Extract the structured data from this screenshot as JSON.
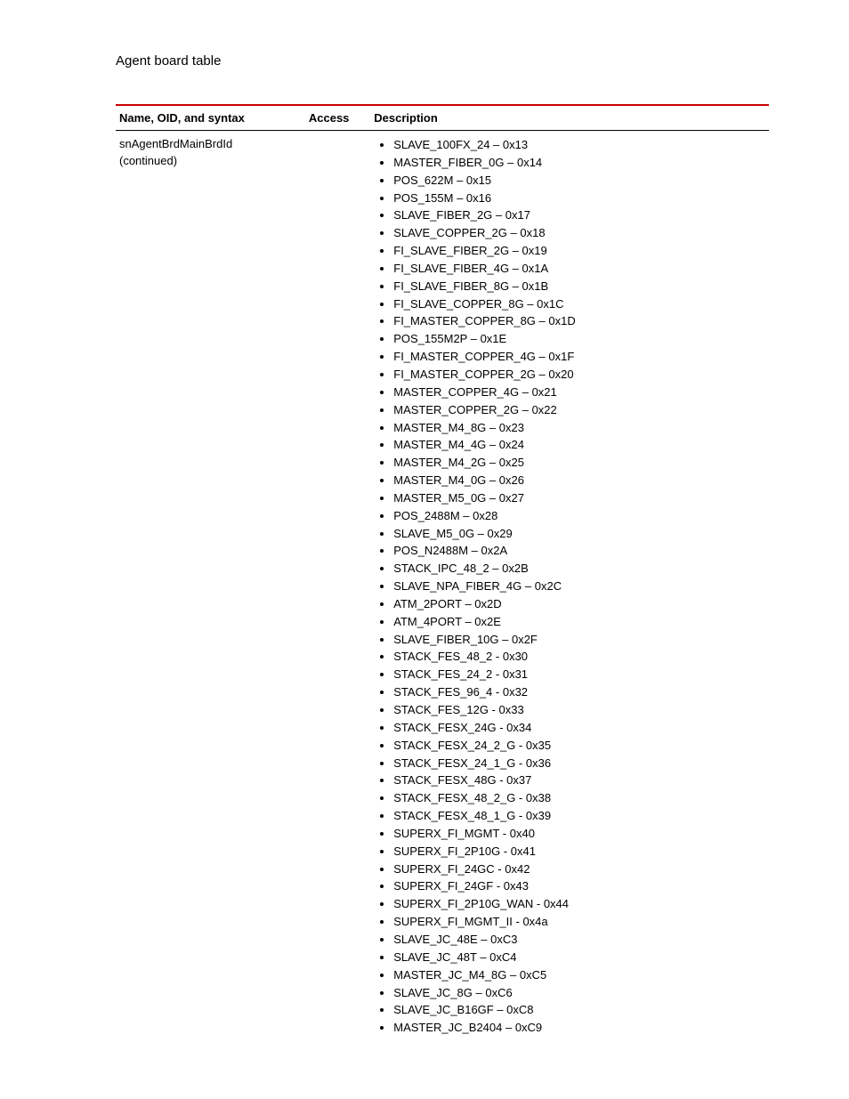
{
  "running_head": "Agent board table",
  "table": {
    "headers": {
      "name": "Name, OID, and syntax",
      "access": "Access",
      "description": "Description"
    },
    "row": {
      "name_line1": "snAgentBrdMainBrdId",
      "name_line2": "(continued)",
      "access": "",
      "values": [
        "SLAVE_100FX_24 – 0x13",
        "MASTER_FIBER_0G – 0x14",
        "POS_622M – 0x15",
        "POS_155M – 0x16",
        "SLAVE_FIBER_2G – 0x17",
        "SLAVE_COPPER_2G – 0x18",
        "FI_SLAVE_FIBER_2G – 0x19",
        "FI_SLAVE_FIBER_4G – 0x1A",
        "FI_SLAVE_FIBER_8G – 0x1B",
        "FI_SLAVE_COPPER_8G – 0x1C",
        "FI_MASTER_COPPER_8G – 0x1D",
        "POS_155M2P – 0x1E",
        "FI_MASTER_COPPER_4G – 0x1F",
        "FI_MASTER_COPPER_2G – 0x20",
        "MASTER_COPPER_4G – 0x21",
        "MASTER_COPPER_2G – 0x22",
        "MASTER_M4_8G – 0x23",
        "MASTER_M4_4G – 0x24",
        "MASTER_M4_2G – 0x25",
        "MASTER_M4_0G – 0x26",
        "MASTER_M5_0G – 0x27",
        "POS_2488M – 0x28",
        "SLAVE_M5_0G – 0x29",
        "POS_N2488M – 0x2A",
        "STACK_IPC_48_2 – 0x2B",
        "SLAVE_NPA_FIBER_4G – 0x2C",
        "ATM_2PORT – 0x2D",
        "ATM_4PORT – 0x2E",
        "SLAVE_FIBER_10G – 0x2F",
        "STACK_FES_48_2 - 0x30",
        "STACK_FES_24_2 - 0x31",
        "STACK_FES_96_4 - 0x32",
        "STACK_FES_12G - 0x33",
        "STACK_FESX_24G - 0x34",
        "STACK_FESX_24_2_G - 0x35",
        "STACK_FESX_24_1_G - 0x36",
        "STACK_FESX_48G - 0x37",
        "STACK_FESX_48_2_G - 0x38",
        "STACK_FESX_48_1_G - 0x39",
        "SUPERX_FI_MGMT - 0x40",
        "SUPERX_FI_2P10G - 0x41",
        "SUPERX_FI_24GC - 0x42",
        "SUPERX_FI_24GF - 0x43",
        "SUPERX_FI_2P10G_WAN - 0x44",
        "SUPERX_FI_MGMT_II - 0x4a",
        "SLAVE_JC_48E – 0xC3",
        "SLAVE_JC_48T – 0xC4",
        "MASTER_JC_M4_8G – 0xC5",
        "SLAVE_JC_8G – 0xC6",
        "SLAVE_JC_B16GF – 0xC8",
        "MASTER_JC_B2404 – 0xC9"
      ]
    }
  }
}
